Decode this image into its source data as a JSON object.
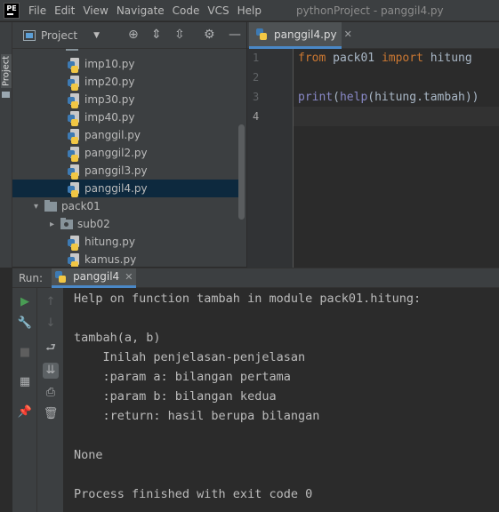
{
  "app": {
    "logo_text": "PE",
    "menu": [
      "File",
      "Edit",
      "View",
      "Navigate",
      "Code",
      "VCS",
      "Help"
    ],
    "window_title": "pythonProject - panggil4.py"
  },
  "left_strip": {
    "project_label": "Project"
  },
  "project_panel": {
    "title": "Project",
    "toolbar_icons": [
      "locate-icon",
      "expand-all-icon",
      "collapse-all-icon",
      "gear-icon",
      "minimize-icon"
    ],
    "partial_top_label": "main",
    "files": [
      {
        "name": "imp10.py"
      },
      {
        "name": "imp20.py"
      },
      {
        "name": "imp30.py"
      },
      {
        "name": "imp40.py"
      },
      {
        "name": "panggil.py"
      },
      {
        "name": "panggil2.py"
      },
      {
        "name": "panggil3.py"
      },
      {
        "name": "panggil4.py",
        "selected": true
      }
    ],
    "pack01": {
      "name": "pack01",
      "children": [
        "sub02",
        "hitung.py",
        "kamus.py"
      ]
    }
  },
  "editor": {
    "tab_label": "panggil4.py",
    "line_numbers": [
      "1",
      "2",
      "3",
      "4"
    ],
    "code": {
      "line1": {
        "kw_from": "from",
        "module": " pack01 ",
        "kw_import": "import",
        "name": " hitung"
      },
      "line3": {
        "fn_print": "print",
        "p1": "(",
        "fn_help": "help",
        "rest": "(hitung.tambah))"
      }
    }
  },
  "run_panel": {
    "label": "Run:",
    "tab_label": "panggil4",
    "output": [
      "Help on function tambah in module pack01.hitung:",
      "",
      "tambah(a, b)",
      "    Inilah penjelasan-penjelasan",
      "    :param a: bilangan pertama",
      "    :param b: bilangan kedua",
      "    :return: hasil berupa bilangan",
      "",
      "None",
      "",
      "Process finished with exit code 0"
    ]
  },
  "colors": {
    "keyword": "#cc7832",
    "builtin": "#8888c6",
    "code_text": "#a9b7c6",
    "selection": "#0d293e",
    "tab_accent": "#4a88c7",
    "run_green": "#499c54"
  }
}
